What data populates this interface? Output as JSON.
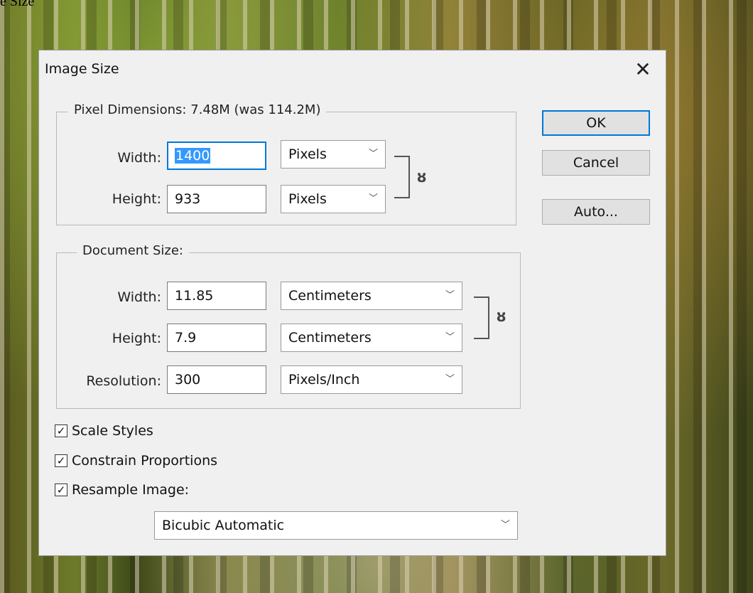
{
  "background_caption": "e Size",
  "dialog": {
    "title": "Image Size",
    "close_glyph": "✕"
  },
  "pixel_dimensions": {
    "title": "Pixel Dimensions:  7.48M (was 114.2M)",
    "width_label": "Width:",
    "width_value": "1400",
    "width_unit": "Pixels",
    "height_label": "Height:",
    "height_value": "933",
    "height_unit": "Pixels"
  },
  "document_size": {
    "title": "Document Size:",
    "width_label": "Width:",
    "width_value": "11.85",
    "width_unit": "Centimeters",
    "height_label": "Height:",
    "height_value": "7.9",
    "height_unit": "Centimeters",
    "resolution_label": "Resolution:",
    "resolution_value": "300",
    "resolution_unit": "Pixels/Inch"
  },
  "buttons": {
    "ok": "OK",
    "cancel": "Cancel",
    "auto": "Auto..."
  },
  "options": {
    "scale_styles": {
      "label": "Scale Styles",
      "checked": true
    },
    "constrain_proportions": {
      "label": "Constrain Proportions",
      "checked": true
    },
    "resample_image": {
      "label": "Resample Image:",
      "checked": true
    },
    "resample_method": "Bicubic Automatic"
  },
  "icons": {
    "chevron": "﹀",
    "link": "ȣ",
    "check": "✓"
  },
  "colors": {
    "dialog_bg": "#f0f0f0",
    "focus_blue": "#0078d7",
    "selection_blue": "#3399ff"
  }
}
